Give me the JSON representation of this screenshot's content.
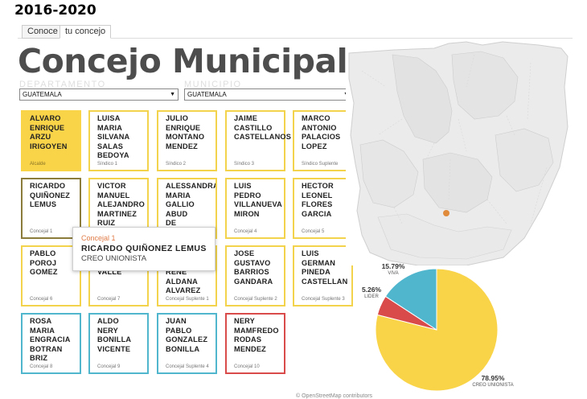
{
  "header": {
    "period": "2016-2020"
  },
  "tabs": [
    {
      "label": "Conoce"
    },
    {
      "label": "tu concejo"
    }
  ],
  "title": "Concejo Municipal",
  "filters": {
    "departamento": {
      "label": "DEPARTAMENTO",
      "value": "GUATEMALA"
    },
    "municipio": {
      "label": "MUNICIPIO",
      "value": "GUATEMALA"
    }
  },
  "members": [
    {
      "name": "ALVARO\nENRIQUE\nARZU\nIRIGOYEN",
      "role": "Alcalde",
      "style": "filled"
    },
    {
      "name": "LUISA\nMARIA\nSILVANA\nSALAS\nBEDOYA",
      "role": "Síndico 1",
      "style": "yellow"
    },
    {
      "name": "JULIO\nENRIQUE\nMONTANO\nMENDEZ",
      "role": "Síndico 2",
      "style": "yellow"
    },
    {
      "name": "JAIME\nCASTILLO\nCASTELLANOS",
      "role": "Síndico 3",
      "style": "yellow"
    },
    {
      "name": "MARCO\nANTONIO\nPALACIOS\nLOPEZ",
      "role": "Síndico Suplente",
      "style": "yellow"
    },
    {
      "name": "RICARDO\nQUIÑONEZ\nLEMUS",
      "role": "Concejal 1",
      "style": "sel"
    },
    {
      "name": "VICTOR\nMANUEL\nALEJANDRO\nMARTINEZ\nRUIZ",
      "role": "",
      "style": "yellow clip"
    },
    {
      "name": "ALESSANDRA\nMARIA\nGALLIO\nABUD\nDE DAVIDSON",
      "role": "",
      "style": "yellow clip"
    },
    {
      "name": "LUIS\nPEDRO\nVILLANUEVA\nMIRON",
      "role": "Concejal 4",
      "style": "yellow"
    },
    {
      "name": "HECTOR\nLEONEL\nFLORES\nGARCIA",
      "role": "Concejal 5",
      "style": "yellow"
    },
    {
      "name": "PABLO\nPOROJ\nGOMEZ",
      "role": "Concejal 6",
      "style": "yellow"
    },
    {
      "name": "\n\nVALLE",
      "role": "Concejal 7",
      "style": "yellow"
    },
    {
      "name": "\n\nRENE\nALDANA\nALVAREZ",
      "role": "Concejal Suplente 1",
      "style": "yellow"
    },
    {
      "name": "JOSE\nGUSTAVO\nBARRIOS\nGANDARA",
      "role": "Concejal Suplente 2",
      "style": "yellow"
    },
    {
      "name": "LUIS\nGERMAN\nPINEDA\nCASTELLAN",
      "role": "Concejal Suplente 3",
      "style": "yellow"
    },
    {
      "name": "ROSA\nMARIA\nENGRACIA\nBOTRAN\nBRIZ",
      "role": "Concejal 8",
      "style": "blue"
    },
    {
      "name": "ALDO\nNERY\nBONILLA\nVICENTE",
      "role": "Concejal 9",
      "style": "blue"
    },
    {
      "name": "JUAN\nPABLO\nGONZALEZ\nBONILLA",
      "role": "Concejal Suplente 4",
      "style": "blue"
    },
    {
      "name": "NERY\nMAMFREDO\nRODAS\nMENDEZ",
      "role": "Concejal 10",
      "style": "red"
    }
  ],
  "tooltip": {
    "role": "Concejal 1",
    "name": "RICARDO QUIÑONEZ LEMUS",
    "party": "CREO UNIONISTA"
  },
  "chart_data": {
    "type": "pie",
    "slices": [
      {
        "label": "CREO UNIONISTA",
        "value": 78.95,
        "color": "#f9d449",
        "pct_text": "78.95%"
      },
      {
        "label": "LIDER",
        "value": 5.26,
        "color": "#d94b4b",
        "pct_text": "5.26%"
      },
      {
        "label": "VIVA",
        "value": 15.79,
        "color": "#4fb6ce",
        "pct_text": "15.79%"
      }
    ]
  },
  "colors": {
    "party_yellow": "#f9d449",
    "party_blue": "#4fb6ce",
    "party_red": "#d94b4b",
    "marker": "#e08a3c"
  },
  "map": {
    "icon": "guatemala-map"
  },
  "credit": "© OpenStreetMap contributors"
}
